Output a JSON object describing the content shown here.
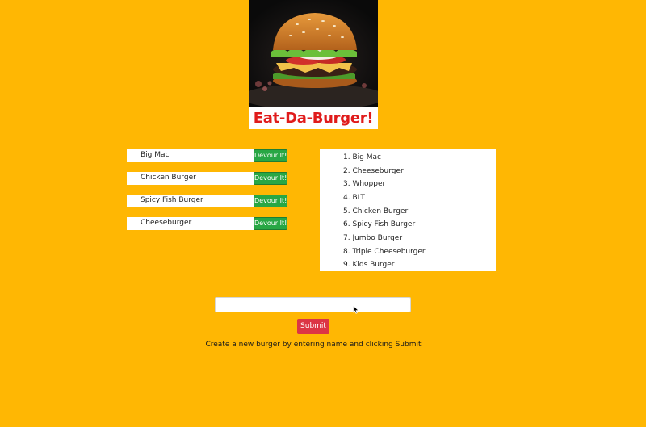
{
  "header": {
    "title": "Eat-Da-Burger!",
    "image_icon": "burger-photo"
  },
  "uneaten": {
    "button_label": "Devour It!",
    "items": [
      {
        "name": "Big Mac"
      },
      {
        "name": "Chicken Burger"
      },
      {
        "name": "Spicy Fish Burger"
      },
      {
        "name": "Cheeseburger"
      }
    ]
  },
  "devoured": {
    "items": [
      "1. Big Mac",
      "2. Cheeseburger",
      "3. Whopper",
      "4. BLT",
      "5. Chicken Burger",
      "6. Spicy Fish Burger",
      "7. Jumbo Burger",
      "8. Triple Cheeseburger",
      "9. Kids Burger"
    ]
  },
  "form": {
    "input_value": "",
    "submit_label": "Submit",
    "help_text": "Create a new burger by entering name and clicking Submit"
  },
  "colors": {
    "background": "#ffb703",
    "title": "#e01b1b",
    "devour_button": "#28a745",
    "submit_button": "#dc3545"
  }
}
